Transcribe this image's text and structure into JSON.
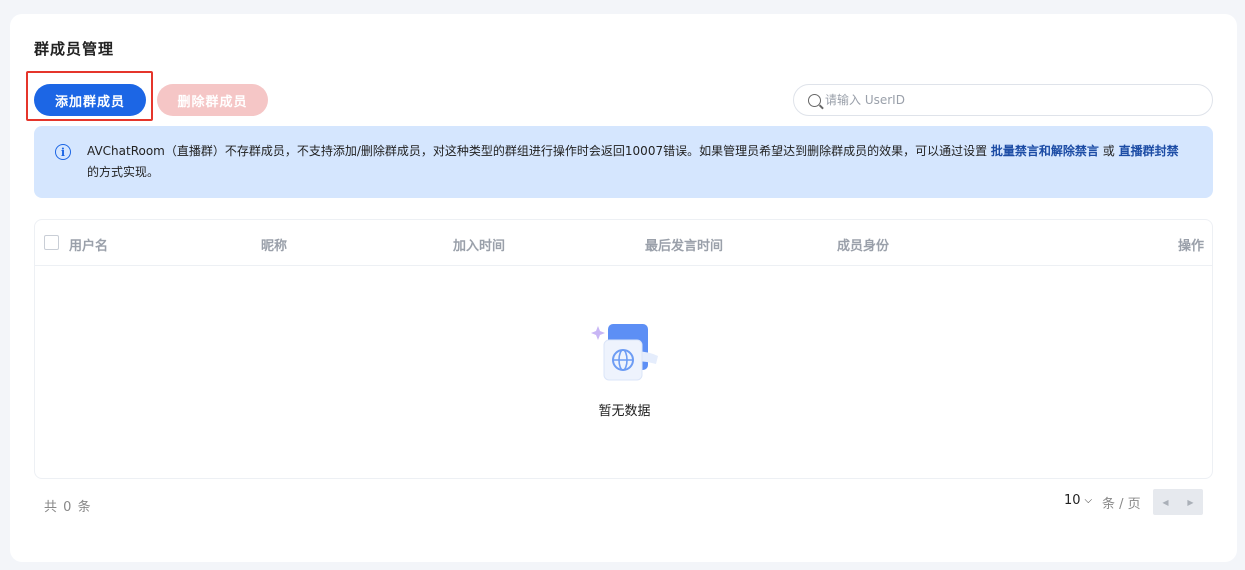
{
  "page": {
    "title": "群成员管理"
  },
  "toolbar": {
    "add_label": "添加群成员",
    "delete_label": "删除群成员"
  },
  "search": {
    "placeholder": "请输入 UserID",
    "value": ""
  },
  "notice": {
    "text_before": "AVChatRoom（直播群）不存群成员，不支持添加/删除群成员，对这种类型的群组进行操作时会返回10007错误。如果管理员希望达到删除群成员的效果，可以通过设置 ",
    "link1": "批量禁言和解除禁言",
    "text_mid": " 或 ",
    "link2": "直播群封禁",
    "text_after": "的方式实现。"
  },
  "table": {
    "columns": [
      "用户名",
      "昵称",
      "加入时间",
      "最后发言时间",
      "成员身份",
      "操作"
    ],
    "rows": [],
    "empty_text": "暂无数据"
  },
  "pagination": {
    "total_prefix": "共",
    "total": "0",
    "total_suffix": "条",
    "page_size": "10",
    "per_page_label": "条 / 页"
  },
  "colors": {
    "primary": "#1c66e5",
    "danger_disabled": "#f5c6c6",
    "notice_bg": "#d5e6fe",
    "highlight": "#e5352b"
  }
}
